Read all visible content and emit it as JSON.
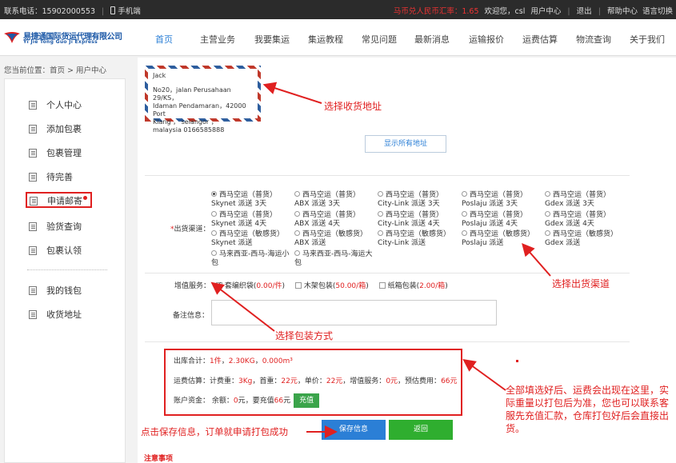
{
  "topbar": {
    "phone": "联系电话：15902000553",
    "mobile": "手机端",
    "rate": "马币兑人民币汇率：1.65",
    "welcome": "欢迎您，csl",
    "user_center": "用户中心",
    "logout": "退出",
    "help": "帮助中心",
    "lang": "语言切换"
  },
  "logo": {
    "cn": "易捷通国际货运代理有限公司",
    "en": "Yi Jie Tong Guo Ji Express"
  },
  "nav": [
    "首页",
    "主营业务",
    "我要集运",
    "集运教程",
    "常见问题",
    "最新消息",
    "运输报价",
    "运费估算",
    "物流查询",
    "关于我们"
  ],
  "breadcrumb": "您当前位置：首页 > 用户中心",
  "sidebar": {
    "items": [
      "个人中心",
      "添加包裹",
      "包裹管理",
      "待完善",
      "申请邮寄",
      "验货查询",
      "包裹认领"
    ],
    "items2": [
      "我的钱包",
      "收货地址"
    ]
  },
  "address": {
    "name": "Jack",
    "line1": "No20，jalan Perusahaan 29/KS，",
    "line2": "Idaman Pendamaran，42000 Port",
    "line3": "Klang ， selangor ，",
    "line4": "malaysia 0166585888"
  },
  "show_all_label": "显示所有地址",
  "channel": {
    "label": "出货渠道：",
    "options": [
      [
        "西马空运（普货）",
        "Skynet 派送 3天"
      ],
      [
        "西马空运（普货）",
        "ABX 派送 3天"
      ],
      [
        "西马空运（普货）",
        "City-Link 派送 3天"
      ],
      [
        "西马空运（普货）",
        "Poslaju 派送 3天"
      ],
      [
        "西马空运（普货）",
        "Gdex 派送 3天"
      ],
      [
        "西马空运（普货）",
        "Skynet 派送 4天"
      ],
      [
        "西马空运（普货）",
        "ABX 派送 4天"
      ],
      [
        "西马空运（普货）",
        "City-Link 派送 4天"
      ],
      [
        "西马空运（普货）",
        "Poslaju 派送 4天"
      ],
      [
        "西马空运（普货）",
        "Gdex 派送 4天"
      ],
      [
        "西马空运（敏感货）",
        "Skynet 派送"
      ],
      [
        "西马空运（敏感货）",
        "ABX 派送"
      ],
      [
        "西马空运（敏感货）",
        "City-Link 派送"
      ],
      [
        "西马空运（敏感货）",
        "Poslaju 派送"
      ],
      [
        "西马空运（敏感货）",
        "Gdex 派送"
      ],
      [
        "马来西亚-西马-海运小",
        "包"
      ],
      [
        "马来西亚-西马-海运大",
        "包"
      ]
    ]
  },
  "value_added": {
    "label": "增值服务：",
    "opt1_name": "套编织袋(",
    "opt1_price": "0.00/件",
    "opt2_name": "木架包装(",
    "opt2_price": "50.00/箱",
    "opt3_name": "纸箱包装(",
    "opt3_price": "2.00/箱",
    "close": ")"
  },
  "remark_label": "备注信息：",
  "summary": {
    "out_label": "出库合计：",
    "pieces": "1件",
    "weight": "2.30KG",
    "volume": "0.000m³",
    "fee_label": "运费估算：计费重：",
    "charge_weight": "3Kg",
    "first_label": "，首重：",
    "first_fee": "22元",
    "unit_label": "，单价：",
    "unit_fee": "22元",
    "va_label": "，增值服务：",
    "va_fee": "0元",
    "est_label": "，预估费用：",
    "est_fee": "66元",
    "acct_label": "账户资金：  余额：",
    "balance": "0",
    "need_label": "元，要充值",
    "need": "66",
    "yuan": "元",
    "charge_btn": "充值"
  },
  "save_label": "保存信息",
  "back_label": "返回",
  "notice": "注意事项",
  "annotations": {
    "a1": "选择收货地址",
    "a2": "选择出货渠道",
    "a3": "选择包装方式",
    "a4": "全部填选好后、运费会出现在这里，实际重量以打包后为准，您也可以联系客服先充值汇款，仓库打包好后会直接出货。",
    "a5": "点击保存信息，订单就申请打包成功"
  }
}
